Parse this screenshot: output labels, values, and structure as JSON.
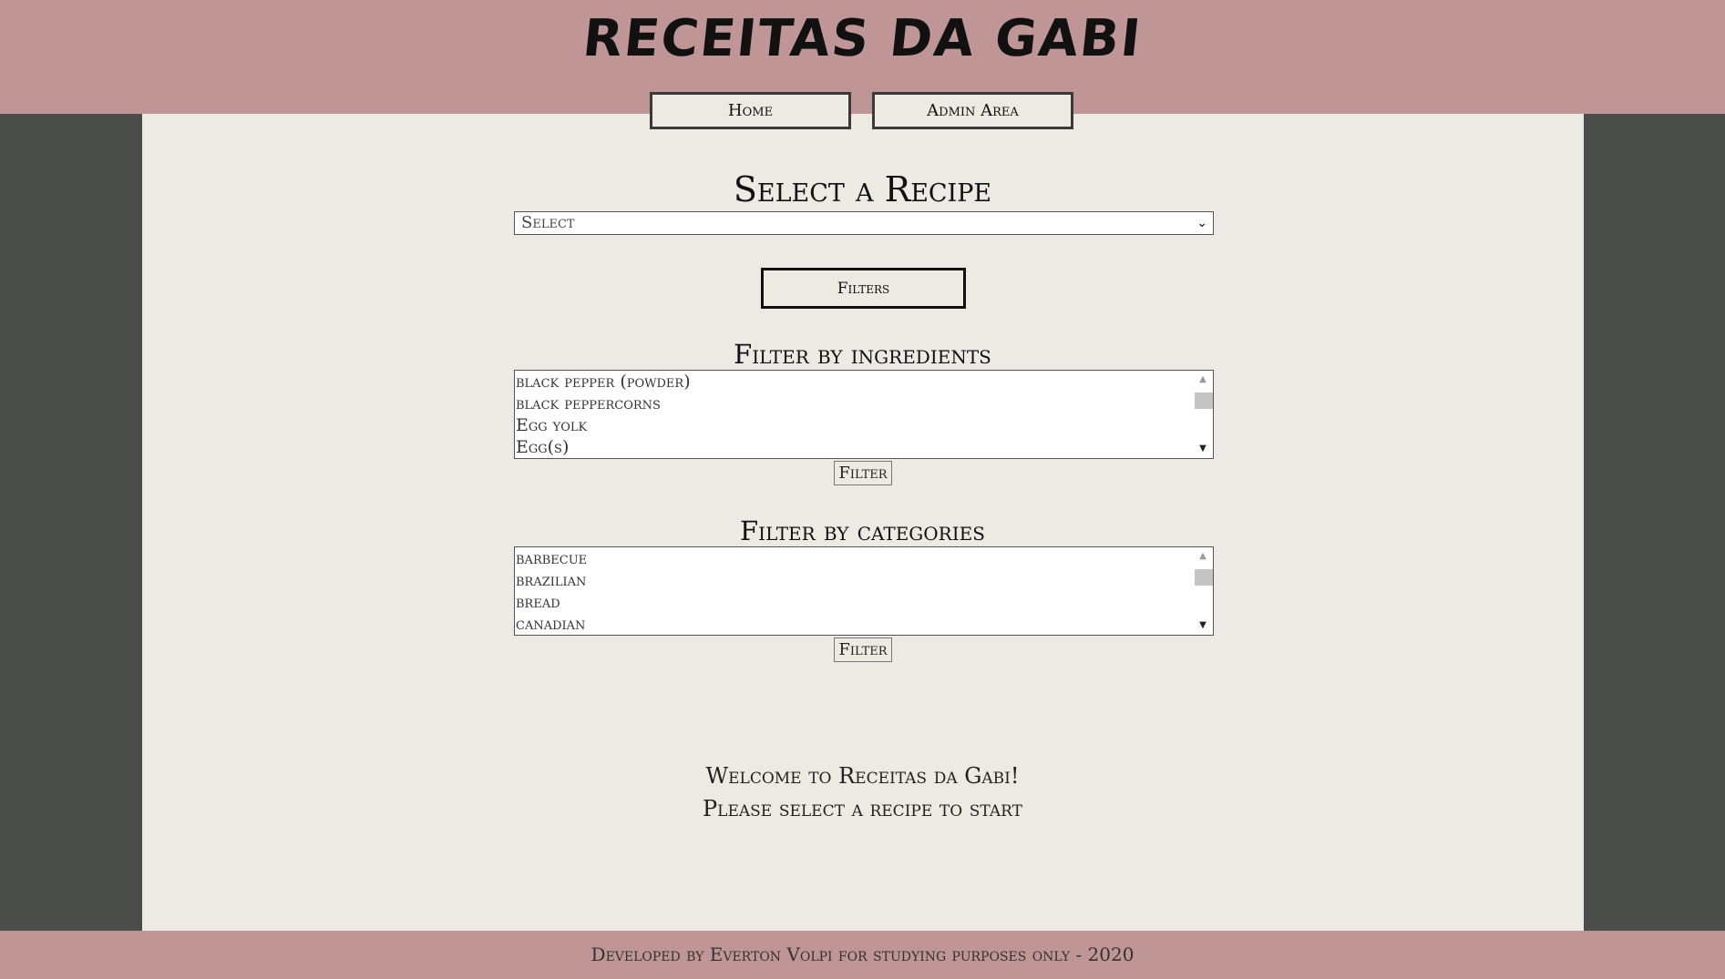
{
  "header": {
    "site_title": "RECEITAS DA GABI",
    "nav": {
      "home_label": "Home",
      "admin_label": "Admin Area"
    }
  },
  "recipe_select": {
    "title": "Select a Recipe",
    "selected_value": "Select"
  },
  "filters_button_label": "Filters",
  "ingredients_filter": {
    "title": "Filter by ingredients",
    "options": [
      "black pepper (powder)",
      "black peppercorns",
      "Egg yolk",
      "Egg(s)"
    ],
    "button_label": "Filter"
  },
  "categories_filter": {
    "title": "Filter by categories",
    "options": [
      "barbecue",
      "brazilian",
      "bread",
      "canadian"
    ],
    "button_label": "Filter"
  },
  "welcome": {
    "line1": "Welcome to Receitas da Gabi!",
    "line2": "Please select a recipe to start"
  },
  "footer": {
    "text": "Developed by Everton Volpi for studying purposes only - 2020"
  }
}
